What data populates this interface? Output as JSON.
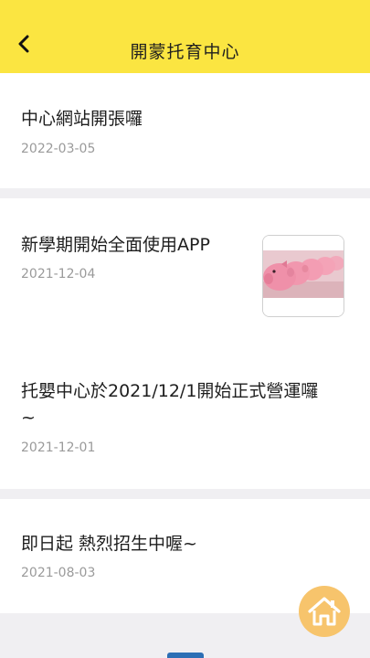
{
  "header": {
    "title": "開蒙托育中心",
    "back_icon": "back-arrow-icon",
    "background_color": "#fbe541"
  },
  "posts": [
    {
      "title": "中心網站開張囉",
      "date": "2022-03-05",
      "has_image": false
    },
    {
      "title": "新學期開始全面使用APP",
      "date": "2021-12-04",
      "has_image": true,
      "image": "pink-piggy-banks-thumbnail"
    },
    {
      "title_line1": "托嬰中心於2021/12/1開始正式營運囉",
      "title_line2": "~",
      "date": "2021-12-01",
      "has_image": false
    },
    {
      "title": "即日起 熱烈招生中喔~",
      "date": "2021-08-03",
      "has_image": false
    }
  ],
  "fab": {
    "icon": "home-icon",
    "color": "#f7c46c"
  }
}
